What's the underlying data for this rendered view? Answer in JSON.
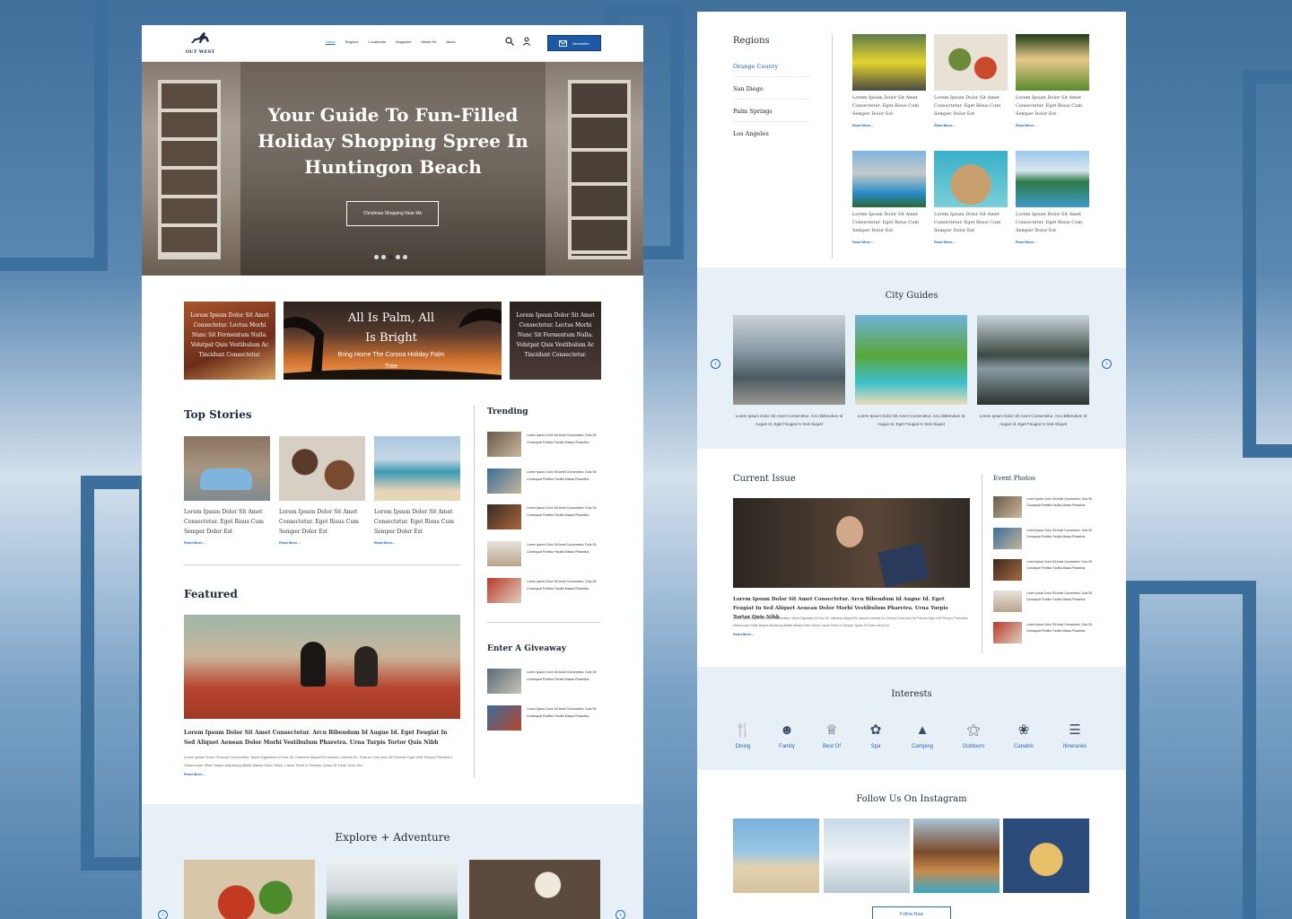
{
  "header": {
    "logo_text": "OUT WEST",
    "logo_sub": "",
    "nav": [
      "Home",
      "Regions",
      "Localendar",
      "Magazine",
      "Media Kit",
      "About"
    ],
    "newsletter_label": "Newsletter"
  },
  "hero": {
    "title": "Your Guide To Fun-Filled Holiday Shopping Spree In Huntingon Beach",
    "cta": "Christmas Shopping Near Me",
    "slide_count": 5,
    "active_slide": 3
  },
  "promos": {
    "left": "Lorem Ipsum Dolor Sit Amet Consectetur. Lectus Morbi Nunc Sit Fermentum Nulla. Volutpat Quis Vestibulum Ac Tincidunt Consectetur.",
    "center_title": "All Is Palm, All Is Bright",
    "center_sub": "Bring Home The Corona Holiday Palm Tree",
    "right": "Lorem Ipsum Dolor Sit Amet Consectetur. Lectus Morbi Nunc Sit Fermentum Nulla. Volutpat Quis Vestibulum Ac Tincidunt Consectetur."
  },
  "top_stories": {
    "title": "Top Stories",
    "items": [
      {
        "text": "Lorem Ipsum Dolor Sit Amet Consectetur. Eget Risus Cum Semper Dolor Est",
        "more": "Read More..."
      },
      {
        "text": "Lorem Ipsum Dolor Sit Amet Consectetur. Eget Risus Cum Semper Dolor Est",
        "more": "Read More..."
      },
      {
        "text": "Lorem Ipsum Dolor Sit Amet Consectetur. Eget Risus Cum Semper Dolor Est",
        "more": "Read More..."
      }
    ]
  },
  "trending": {
    "title": "Trending",
    "item_text": "Lorem Ipsum Dolor Sit Amet Consectetur. Duis Sit Consequat Porttitor Facilisi Massa Phasellus.",
    "count": 5
  },
  "giveaway": {
    "title": "Enter A Giveaway",
    "item_text": "Lorem Ipsum Dolor Sit Amet Consectetur. Duis Sit Consequat Porttitor Facilisi Massa Phasellus."
  },
  "featured": {
    "title": "Featured",
    "headline": "Lorem Ipsum Dolor Sit Amet Consectetur. Arcu Bibendum Id Augue Id. Eget Feugiat In Sed Aliquet Aenean Dolor Morbi Vestibulum Pharetra. Urna Turpis Tortor Quis Nibh",
    "body": "Lorem Ipsum Dolor Sit Amet Consectetur. Morbi Dignissim At Non Sit. Interdum Aliquet Eu Mauris Lobortis Eu. Rutrum Cras Arcu At Pulvinar Eget Velit Tempor Parturient. Ullamcorper Vitae Neque Adipiscing Mattis Massa Diam Tellus. Lacus Tortor In Semper Quam M Tortor Urna Dui.",
    "more": "Read More..."
  },
  "explore": {
    "title": "Explore + Adventure"
  },
  "regions": {
    "title": "Regions",
    "items": [
      "Orange County",
      "San Diego",
      "Palm Springs",
      "Los Angeles"
    ],
    "card_text": "Lorem Ipsum Dolor Sit Amet Consectetur. Eget Risus Cum Semper Dolor Est",
    "more": "Read More..."
  },
  "city_guides": {
    "title": "City Guides",
    "card_text": "Lorem Ipsum Dolor Sit Amet Consectetur. Arcu Bibendum Id Augue Id. Eget Feugiat In Sed Aliquet"
  },
  "current_issue": {
    "title": "Current Issue",
    "headline": "Lorem Ipsum Dolor Sit Amet Consectetur. Arcu Bibendum Id Augue Id. Eget Feugiat In Sed Aliquet Aenean Dolor Morbi Vestibulum Pharetra. Urna Turpis Tortor Quis Nibh",
    "body": "Lorem Ipsum Dolor Sit Amet Consectetur. Morbi Dignissim At Non Sit. Interdum Aliquet Eu Mauris Lobortis Eu. Rutrum Cras Arcu At Pulvinar Eget Velit Tempor Parturient. Ullamcorper Vitae Neque Adipiscing Mattis Massa Diam Tellus. Lacus Tortor In Semper Quam M Tortor Urna Dui.",
    "more": "Read More..."
  },
  "event_photos": {
    "title": "Event Photos",
    "item_text": "Lorem Ipsum Dolor Sit Amet Consectetur. Duis Sit Consequat Porttitor Facilisi Massa Phasellus."
  },
  "interests": {
    "title": "Interests",
    "items": [
      {
        "label": "Dining",
        "icon": "dining-icon"
      },
      {
        "label": "Family",
        "icon": "family-icon"
      },
      {
        "label": "Best Of",
        "icon": "trophy-icon"
      },
      {
        "label": "Spa",
        "icon": "spa-icon"
      },
      {
        "label": "Camping",
        "icon": "tent-icon"
      },
      {
        "label": "Outdoors",
        "icon": "hiker-icon"
      },
      {
        "label": "Canabis",
        "icon": "leaf-icon"
      },
      {
        "label": "Itineraries",
        "icon": "itinerary-icon"
      }
    ]
  },
  "instagram": {
    "title": "Follow Us On Instagram",
    "button": "Follow Now"
  },
  "colors": {
    "accent": "#1d59a5",
    "link": "#2a66b5",
    "band": "#e8f0f7",
    "background": "#4f7fab"
  }
}
